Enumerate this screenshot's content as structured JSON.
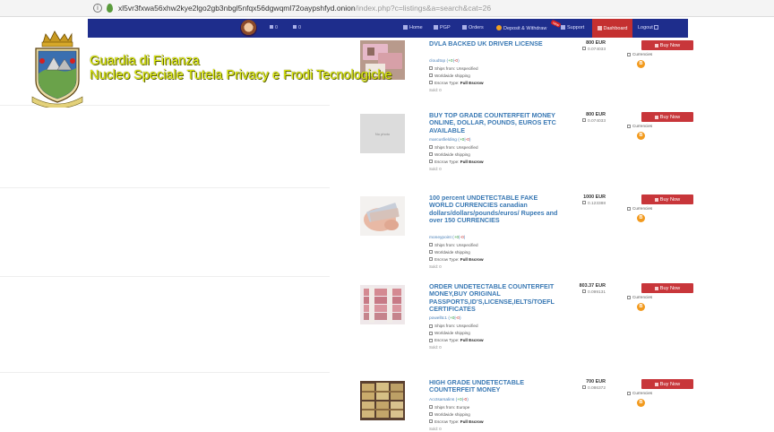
{
  "address_bar": {
    "host": "xl5vr3fxwa56xhw2kye2lgo2gb3nbgl5nfqx56dgwqml72oaypshfyd.onion",
    "path": "/index.php?c=listings&a=search&cat=26"
  },
  "nav": {
    "count_1": "0",
    "count_2": "0",
    "items": {
      "home": "Home",
      "pgp": "PGP",
      "orders": "Orders",
      "deposit": "Deposit & Withdraw",
      "support": "Support",
      "dashboard": "Dashboard",
      "logout": "Logout"
    },
    "new_badge": "new"
  },
  "overlay": {
    "line1": "Guardia di Finanza",
    "line2": "Nucleo Speciale Tutela Privacy e Frodi Tecnologiche"
  },
  "labels": {
    "buy_now": "Buy Now",
    "currencies": "Currencies",
    "ships_from": "Ships from:",
    "worldwide": "Worldwide shipping",
    "escrow": "Escrow Type:",
    "escrow_value": "Full Escrow",
    "no_photo": "No photo",
    "btc_symbol": "B"
  },
  "listings": [
    {
      "title": "DVLA BACKED UK DRIVER LICENSE",
      "vendor": "cloudtop",
      "feedback_plus": "+0",
      "feedback_minus": "-0",
      "ships_from": "Unspecified",
      "price": "800 EUR",
      "btc": "0.074033",
      "sold": "Sold: 0",
      "image": "doc"
    },
    {
      "title": "BUY TOP GRADE COUNTERFEIT MONEY ONLINE, DOLLAR, POUNDS, EUROS ETC AVAILABLE",
      "vendor": "marcusfielding",
      "feedback_plus": "+0",
      "feedback_minus": "-0",
      "ships_from": "Unspecified",
      "price": "800 EUR",
      "btc": "0.074033",
      "sold": "Sold: 0",
      "image": "none"
    },
    {
      "title": "100 percent UNDETECTABLE FAKE WORLD CURRENCIES canadian dollars/dollars/pounds/euros/ Rupees and over 150 CURRENCIES",
      "vendor": "moneypoint",
      "feedback_plus": "+0",
      "feedback_minus": "-0",
      "ships_from": "Unspecified",
      "price": "1000 EUR",
      "btc": "0.123388",
      "sold": "Sold: 0",
      "image": "hand"
    },
    {
      "title": "ORDER UNDETECTABLE COUNTERFEIT MONEY,BUY ORIGINAL PASSPORTS,ID'S,LICENSE,IELTS/TOEFL CERTIFICATES",
      "vendor": "powelltc1",
      "feedback_plus": "+0",
      "feedback_minus": "-0",
      "ships_from": "Unspecified",
      "price": "803.37 EUR",
      "btc": "0.099131",
      "sold": "Sold: 0",
      "image": "stack"
    },
    {
      "title": "HIGH GRADE UNDETECTABLE COUNTERFEIT MONEY",
      "vendor": "Acctsarsalins",
      "feedback_plus": "+0",
      "feedback_minus": "-0",
      "ships_from": "Europe",
      "price": "700 EUR",
      "btc": "0.086372",
      "sold": "Sold: 0",
      "image": "bundles"
    }
  ]
}
